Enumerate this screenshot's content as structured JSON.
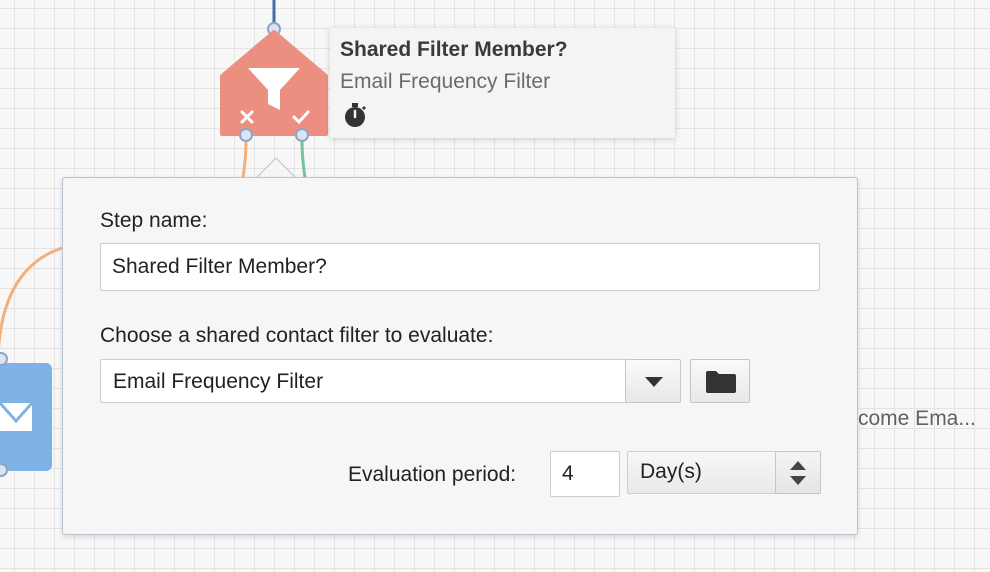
{
  "node": {
    "title": "Shared Filter Member?",
    "subtitle": "Email Frequency Filter",
    "icon": "funnel-icon",
    "status_icon": "stopwatch-icon",
    "color": "#ed8f80"
  },
  "background": {
    "partial_label": "come Ema..."
  },
  "popup": {
    "step_name_label": "Step name:",
    "step_name_value": "Shared Filter Member?",
    "filter_label": "Choose a shared contact filter to evaluate:",
    "filter_value": "Email Frequency Filter",
    "evaluation_label": "Evaluation period:",
    "evaluation_value": "4",
    "period_unit": "Day(s)"
  },
  "colors": {
    "no_path": "#f4b07a",
    "yes_path": "#76c29a",
    "email_node": "#7fb3e6",
    "top_line": "#3f6fa8"
  }
}
